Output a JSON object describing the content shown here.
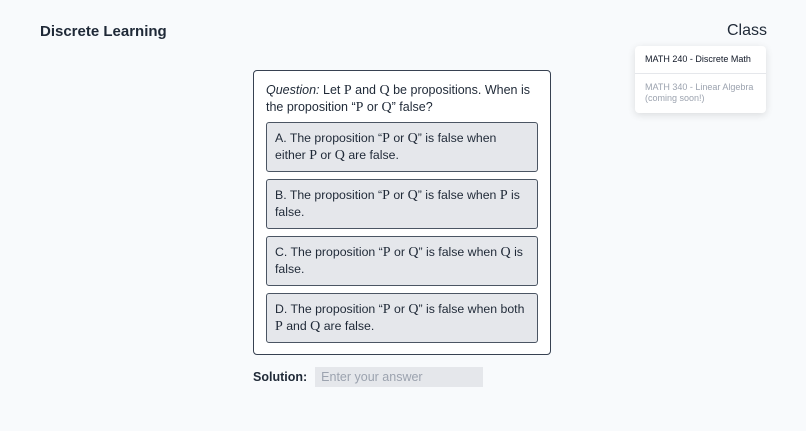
{
  "header": {
    "brand": "Discrete Learning",
    "class_menu_label": "Class"
  },
  "class_dropdown": {
    "items": [
      {
        "label": "MATH 240 - Discrete Math",
        "state": "active"
      },
      {
        "label": "MATH 340 - Linear Algebra (coming soon!)",
        "state": "disabled"
      }
    ]
  },
  "question": {
    "prefix": "Question:",
    "text_parts": [
      "Let",
      "P",
      "and",
      "Q",
      "be propositions. When is the proposition “",
      "P",
      "or",
      "Q",
      "” false?"
    ],
    "options": [
      {
        "id": "A",
        "parts": [
          "A. The proposition “",
          "P",
          "or",
          "Q",
          "” is false when either",
          "P",
          "or",
          "Q",
          "are false."
        ]
      },
      {
        "id": "B",
        "parts": [
          "B. The proposition “",
          "P",
          "or",
          "Q",
          "” is false when",
          "P",
          "is false."
        ]
      },
      {
        "id": "C",
        "parts": [
          "C. The proposition “",
          "P",
          "or",
          "Q",
          "” is false when",
          "Q",
          "is false."
        ]
      },
      {
        "id": "D",
        "parts": [
          "D. The proposition “",
          "P",
          "or",
          "Q",
          "” is false when both",
          "P",
          "and",
          "Q",
          "are false."
        ]
      }
    ]
  },
  "solution": {
    "label": "Solution:",
    "placeholder": "Enter your answer",
    "value": ""
  },
  "colors": {
    "background": "#f8fafc",
    "option_bg": "#e5e7eb",
    "card_border": "#374151"
  }
}
